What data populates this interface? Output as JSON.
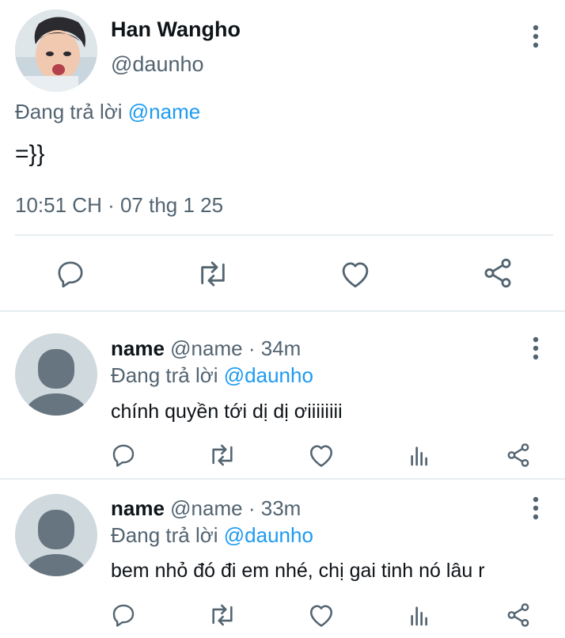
{
  "main_tweet": {
    "display_name": "Han Wangho",
    "handle": "@daunho",
    "replying_prefix": "Đang trả lời ",
    "replying_to": "@name",
    "text": "=}}",
    "timestamp": "10:51 CH · 07 thg 1 25",
    "actions": [
      "reply-icon",
      "retweet-icon",
      "like-icon",
      "share-icon"
    ],
    "more_icon": "more-vertical-icon"
  },
  "replies": [
    {
      "display_name": "name",
      "handle": "@name",
      "separator": "·",
      "time": "34m",
      "replying_prefix": "Đang trả lời ",
      "replying_to": "@daunho",
      "text": "chính quyền tới dị dị ơiiiiiiii",
      "actions": [
        "reply-icon",
        "retweet-icon",
        "like-icon",
        "analytics-icon",
        "share-icon"
      ]
    },
    {
      "display_name": "name",
      "handle": "@name",
      "separator": "·",
      "time": "33m",
      "replying_prefix": "Đang trả lời ",
      "replying_to": "@daunho",
      "text": "bem nhỏ đó đi em nhé, chị gai tinh nó lâu r",
      "actions": [
        "reply-icon",
        "retweet-icon",
        "like-icon",
        "analytics-icon",
        "share-icon"
      ]
    }
  ],
  "colors": {
    "text": "#0f1419",
    "secondary": "#536471",
    "link": "#1d9bf0",
    "divider": "#e6ecf0",
    "avatar_bg": "#cfd9de",
    "avatar_figure": "#66757f"
  }
}
